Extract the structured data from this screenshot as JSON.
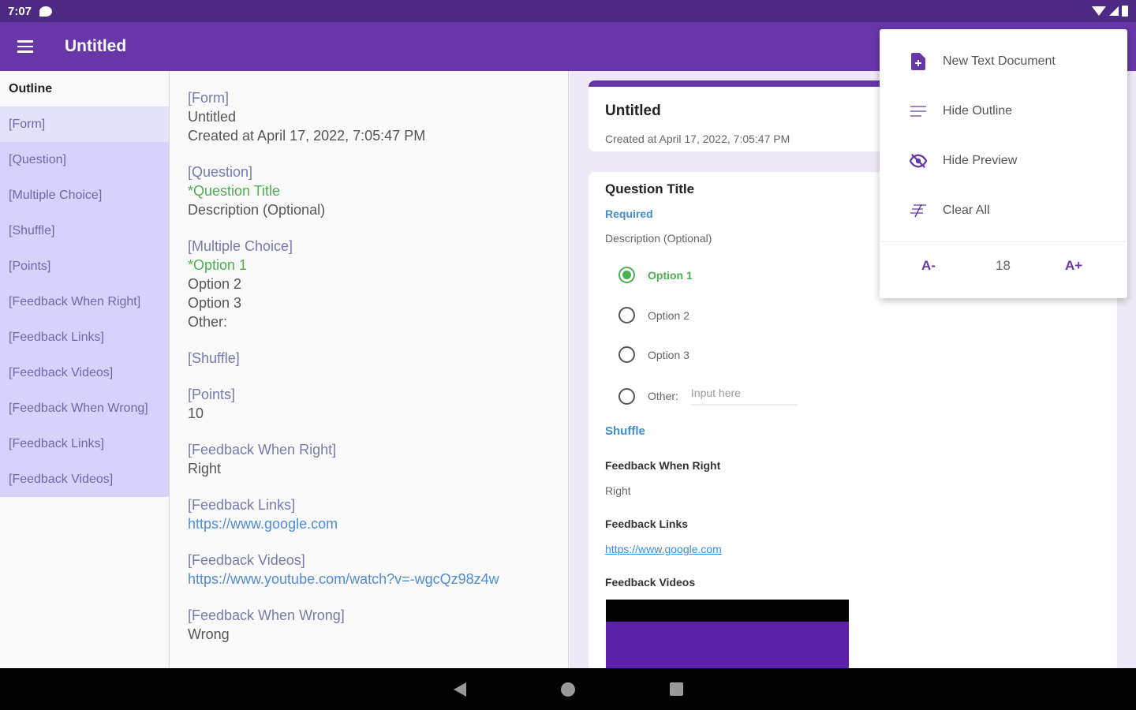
{
  "status": {
    "time": "7:07"
  },
  "app_bar": {
    "title": "Untitled"
  },
  "outline": {
    "header": "Outline",
    "items": [
      {
        "label": "[Form]"
      },
      {
        "label": "[Question]"
      },
      {
        "label": "[Multiple Choice]"
      },
      {
        "label": "[Shuffle]"
      },
      {
        "label": "[Points]"
      },
      {
        "label": "[Feedback When Right]"
      },
      {
        "label": "[Feedback Links]"
      },
      {
        "label": "[Feedback Videos]"
      },
      {
        "label": "[Feedback When Wrong]"
      },
      {
        "label": "[Feedback Links]"
      },
      {
        "label": "[Feedback Videos]"
      }
    ]
  },
  "editor": {
    "form_tag": "[Form]",
    "form_title": "Untitled",
    "form_created": "Created at April 17, 2022, 7:05:47 PM",
    "question_tag": "[Question]",
    "question_title": "*Question Title",
    "question_desc": "Description (Optional)",
    "mc_tag": "[Multiple Choice]",
    "mc_option1": "*Option 1",
    "mc_option2": "Option 2",
    "mc_option3": "Option 3",
    "mc_other": "Other:",
    "shuffle_tag": "[Shuffle]",
    "points_tag": "[Points]",
    "points_value": "10",
    "fb_right_tag": "[Feedback When Right]",
    "fb_right_value": "Right",
    "fb_links_tag": "[Feedback Links]",
    "fb_links_value": "https://www.google.com",
    "fb_videos_tag": "[Feedback Videos]",
    "fb_videos_value": "https://www.youtube.com/watch?v=-wgcQz98z4w",
    "fb_wrong_tag": "[Feedback When Wrong]",
    "fb_wrong_value": "Wrong"
  },
  "preview": {
    "form_title": "Untitled",
    "form_created": "Created at April 17, 2022, 7:05:47 PM",
    "question_title": "Question Title",
    "required": "Required",
    "description": "Description (Optional)",
    "options": [
      "Option 1",
      "Option 2",
      "Option 3"
    ],
    "other_label": "Other:",
    "other_placeholder": "Input here",
    "shuffle": "Shuffle",
    "fb_right_label": "Feedback When Right",
    "fb_right_value": "Right",
    "fb_links_label": "Feedback Links",
    "fb_links_value": "https://www.google.com",
    "fb_videos_label": "Feedback Videos"
  },
  "popup_menu": {
    "new_text_document": "New Text Document",
    "hide_outline": "Hide Outline",
    "hide_preview": "Hide Preview",
    "clear_all": "Clear All",
    "font_minus": "A-",
    "font_size": "18",
    "font_plus": "A+"
  },
  "colors": {
    "status_bar": "#4e2a84",
    "app_bar": "#6737a9",
    "outline_bg": "#d6d2fb",
    "accent_green": "#4caf50",
    "link_blue": "#3f8cd6"
  }
}
